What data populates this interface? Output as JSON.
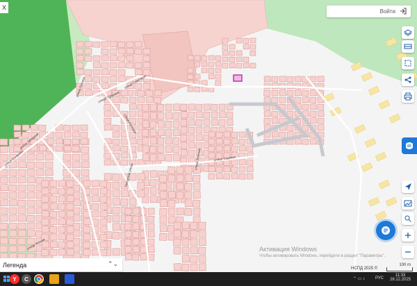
{
  "header": {
    "login_label": "Войти",
    "top_left_close": "X"
  },
  "map": {
    "streets": [
      {
        "name": "улица Бухарова"
      },
      {
        "name": "улица Луговая"
      },
      {
        "name": "улица Советская"
      },
      {
        "name": "улица Трудовая"
      },
      {
        "name": "улица Полевая"
      },
      {
        "name": "улица Садовая"
      },
      {
        "name": "Заводская улица"
      },
      {
        "name": "улица Западная"
      },
      {
        "name": "улица Зеленая"
      },
      {
        "name": "улица Речная"
      }
    ],
    "scale_label": "100 m",
    "attribution": "НСПД 2025 ©"
  },
  "legend": {
    "label": "Легенда"
  },
  "watermark": {
    "title": "Активация Windows",
    "subtitle": "Чтобы активировать Windows, перейдите в раздел \"Параметры\"."
  },
  "taskbar": {
    "lang": "РУС",
    "time": "11:33",
    "date": "28.12.2025"
  },
  "colors": {
    "parcel": "#f8d1cf",
    "parcel_border": "#d9a4a1",
    "green": "#b7e4b4",
    "dark_green": "#4fb457",
    "yellow": "#f7e6a3",
    "accent": "#1d7ad8"
  }
}
